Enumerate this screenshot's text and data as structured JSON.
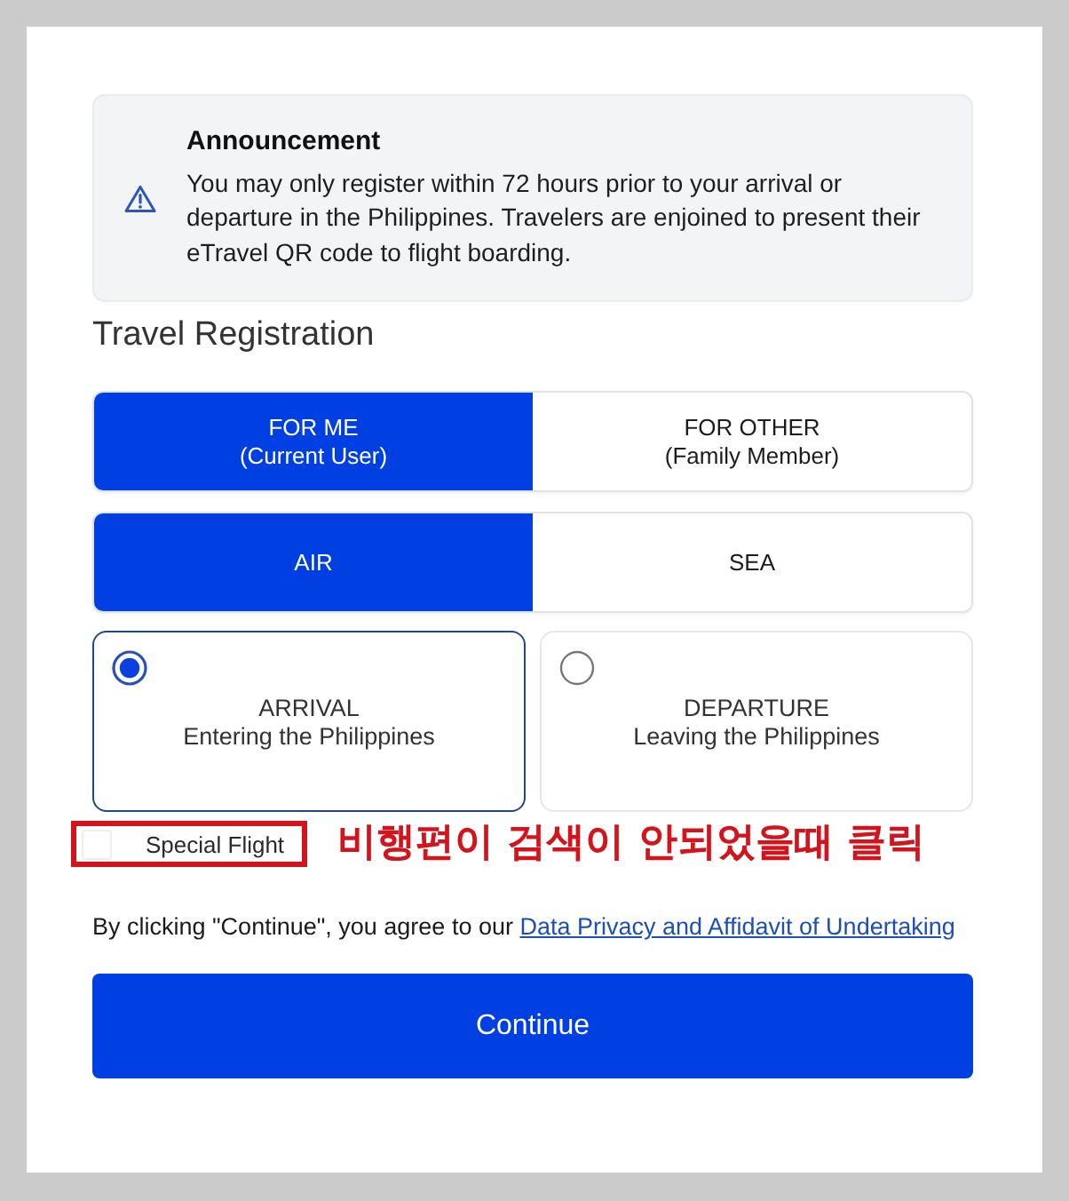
{
  "announcement": {
    "title": "Announcement",
    "message": "You may only register within 72 hours prior to your arrival or departure in the Philippines. Travelers are enjoined to present their eTravel QR code to flight boarding."
  },
  "registration": {
    "heading": "Travel Registration",
    "traveler_options": [
      {
        "label": "FOR ME",
        "sublabel": "(Current User)",
        "selected": true
      },
      {
        "label": "FOR OTHER",
        "sublabel": "(Family Member)",
        "selected": false
      }
    ],
    "transport_options": [
      {
        "label": "AIR",
        "selected": true
      },
      {
        "label": "SEA",
        "selected": false
      }
    ],
    "direction_options": [
      {
        "label": "ARRIVAL",
        "sublabel": "Entering the Philippines",
        "selected": true
      },
      {
        "label": "DEPARTURE",
        "sublabel": "Leaving the Philippines",
        "selected": false
      }
    ],
    "special_flight": {
      "label": "Special Flight",
      "checked": false
    },
    "annotation": {
      "text": "비행편이 검색이 안되었을때 클릭"
    }
  },
  "consent": {
    "text": "By clicking \"Continue\", you agree to our",
    "link": "Data Privacy and Affidavit of Undertaking"
  },
  "continue_button": {
    "label": "Continue"
  }
}
